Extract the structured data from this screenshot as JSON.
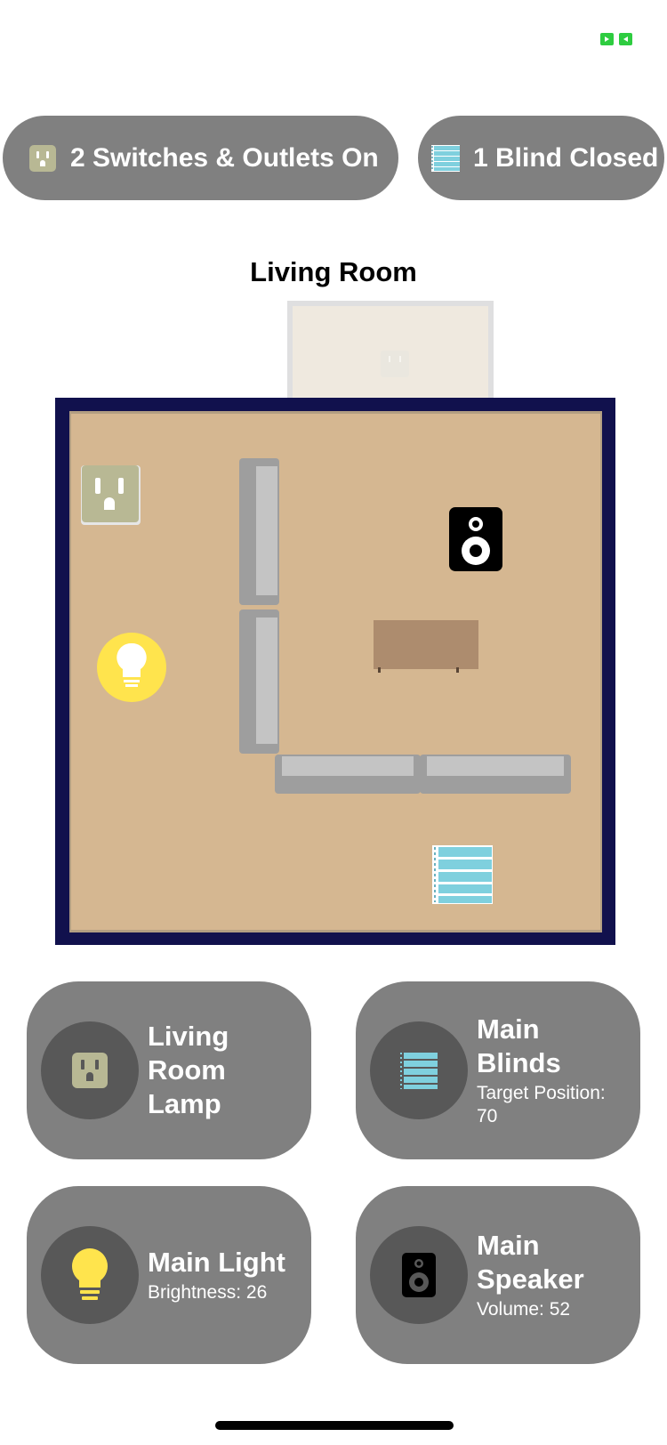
{
  "summary": {
    "switches_label": "2 Switches & Outlets On",
    "blinds_label": "1 Blind Closed"
  },
  "room": {
    "title": "Living Room"
  },
  "icons": {
    "outlet": "outlet-icon",
    "blinds": "blinds-icon",
    "light": "lightbulb-icon",
    "speaker": "speaker-icon",
    "status": "screen-mirroring-icon"
  },
  "colors": {
    "pill_bg": "#808080",
    "tile_bg": "#808080",
    "icon_circle": "#585858",
    "room_border": "#11114d",
    "room_floor": "#d5b791",
    "bulb": "#ffe44d",
    "outlet": "#b8b894",
    "blinds": "#7fd0de",
    "status_green": "#2ecc40"
  },
  "accessories": [
    {
      "name": "Living Room Lamp",
      "detail": ""
    },
    {
      "name": "Main Blinds",
      "detail": "Target Position: 70"
    },
    {
      "name": "Main Light",
      "detail": "Brightness: 26"
    },
    {
      "name": "Main Speaker",
      "detail": "Volume: 52"
    }
  ]
}
